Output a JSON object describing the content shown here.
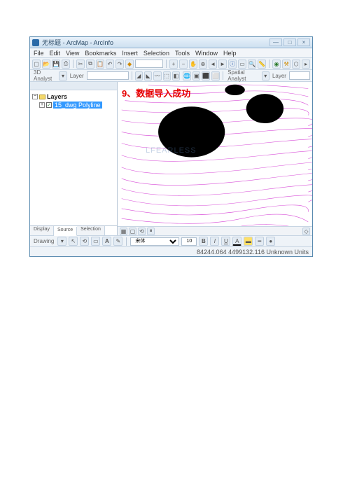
{
  "window": {
    "title": "无标题 - ArcMap - ArcInfo",
    "min": "—",
    "max": "□",
    "close": "×"
  },
  "menubar": [
    "File",
    "Edit",
    "View",
    "Bookmarks",
    "Insert",
    "Selection",
    "Tools",
    "Window",
    "Help"
  ],
  "toolbar1": {
    "analyst_label": "3D Analyst",
    "layer_label": "Layer"
  },
  "toolbar2": {
    "spatial_label": "Spatial Analyst",
    "layer_label": "Layer"
  },
  "toc": {
    "root": "Layers",
    "layer_name": "15_dwg Polyline",
    "checked": "✓",
    "tabs": [
      "Display",
      "Source",
      "Selection"
    ],
    "active_tab": 1
  },
  "map": {
    "annotation": "9、数据导入成功",
    "watermark": "LFEARLESS"
  },
  "drawing": {
    "label": "Drawing",
    "font_select": "宋体",
    "font_size": "10",
    "bold": "B",
    "italic": "I",
    "underline": "U",
    "text_btn": "A"
  },
  "statusbar": {
    "coords": "84244.064  4499132.116 Unknown Units"
  }
}
